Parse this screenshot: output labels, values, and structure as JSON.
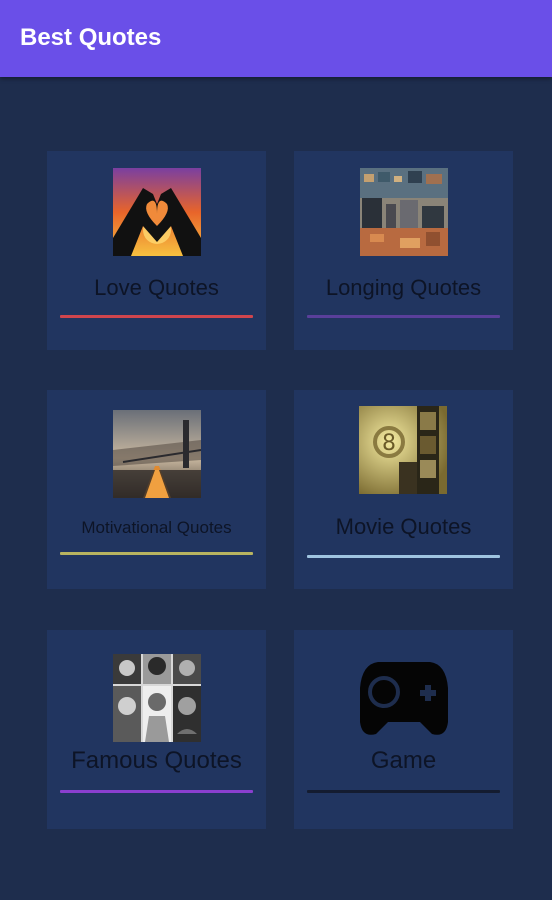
{
  "appbar": {
    "title": "Best Quotes"
  },
  "colors": {
    "appbar": "#6a4fe8",
    "background": "#1e2d4d",
    "card": "#213560",
    "label_text": "#0d1426"
  },
  "cards": [
    {
      "label": "Love Quotes",
      "icon": "heart-hands-sunset-icon",
      "underline": "#d0454d"
    },
    {
      "label": "Longing Quotes",
      "icon": "city-collage-icon",
      "underline": "#5a3f9a"
    },
    {
      "label": "Motivational Quotes",
      "icon": "bridge-road-icon",
      "underline": "#b8b460"
    },
    {
      "label": "Movie Quotes",
      "icon": "film-strip-icon",
      "underline": "#9fc4e0"
    },
    {
      "label": "Famous Quotes",
      "icon": "portrait-collage-icon",
      "underline": "#8a3fcf"
    },
    {
      "label": "Game",
      "icon": "gamepad-icon",
      "underline": "#141c30"
    }
  ]
}
